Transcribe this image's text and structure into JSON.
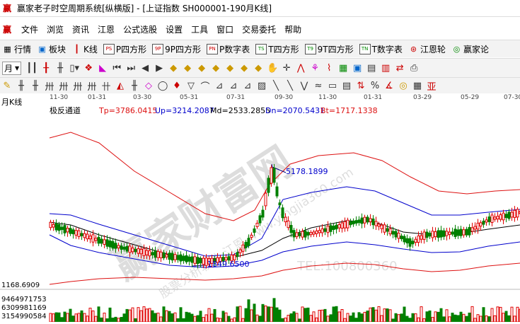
{
  "window": {
    "title": "赢家老子时空周期系统[纵横版] - [上证指数  SH000001-190月K线]"
  },
  "menu": [
    "文件",
    "浏览",
    "资讯",
    "江恩",
    "公式选股",
    "设置",
    "工具",
    "窗口",
    "交易委托",
    "帮助"
  ],
  "toolbar1": [
    {
      "label": "行情",
      "icon": "grid-icon"
    },
    {
      "label": "板块",
      "icon": "blocks-icon"
    },
    {
      "label": "K线",
      "icon": "candles-icon"
    },
    {
      "label": "P四方形",
      "icon": "PS"
    },
    {
      "label": "9P四方形",
      "icon": "9P"
    },
    {
      "label": "P数字表",
      "icon": "PN"
    },
    {
      "label": "T四方形",
      "icon": "TS"
    },
    {
      "label": "9T四方形",
      "icon": "T9"
    },
    {
      "label": "T数字表",
      "icon": "TN"
    },
    {
      "label": "江恩轮",
      "icon": "wheel-icon"
    },
    {
      "label": "赢家论",
      "icon": "talk-icon"
    }
  ],
  "toolbar2": {
    "period": "月"
  },
  "chart": {
    "panel_label": "月K线",
    "indicator": {
      "name": "极反通道",
      "tp": "Tp=3786.0415",
      "up": "Up=3214.2087",
      "md": "Md=2533.2855",
      "dn": "Dn=2070.5431",
      "bt": "Bt=1717.1338"
    },
    "x_ticks": [
      "11-30",
      "01-31",
      "03-30",
      "05-31",
      "07-31",
      "09-30",
      "11-30",
      "01-31",
      "03-29",
      "05-29",
      "07-30"
    ],
    "high_label": "5178.1899",
    "low_label": "1849.6500",
    "price_tick": "1168.6909",
    "volume_ticks": [
      "9464971753",
      "6309981169",
      "3154990584"
    ],
    "watermark_main": "赢家财富网",
    "watermark_sub": "股票分析软件 江恩 www.yingjia360.com",
    "watermark_phone": "TEL:100800360",
    "colors": {
      "up": "#e00000",
      "down": "#008000",
      "indicator": "#000080",
      "channel_outer": "#dd1111",
      "channel_mid": "#0000cc"
    }
  }
}
